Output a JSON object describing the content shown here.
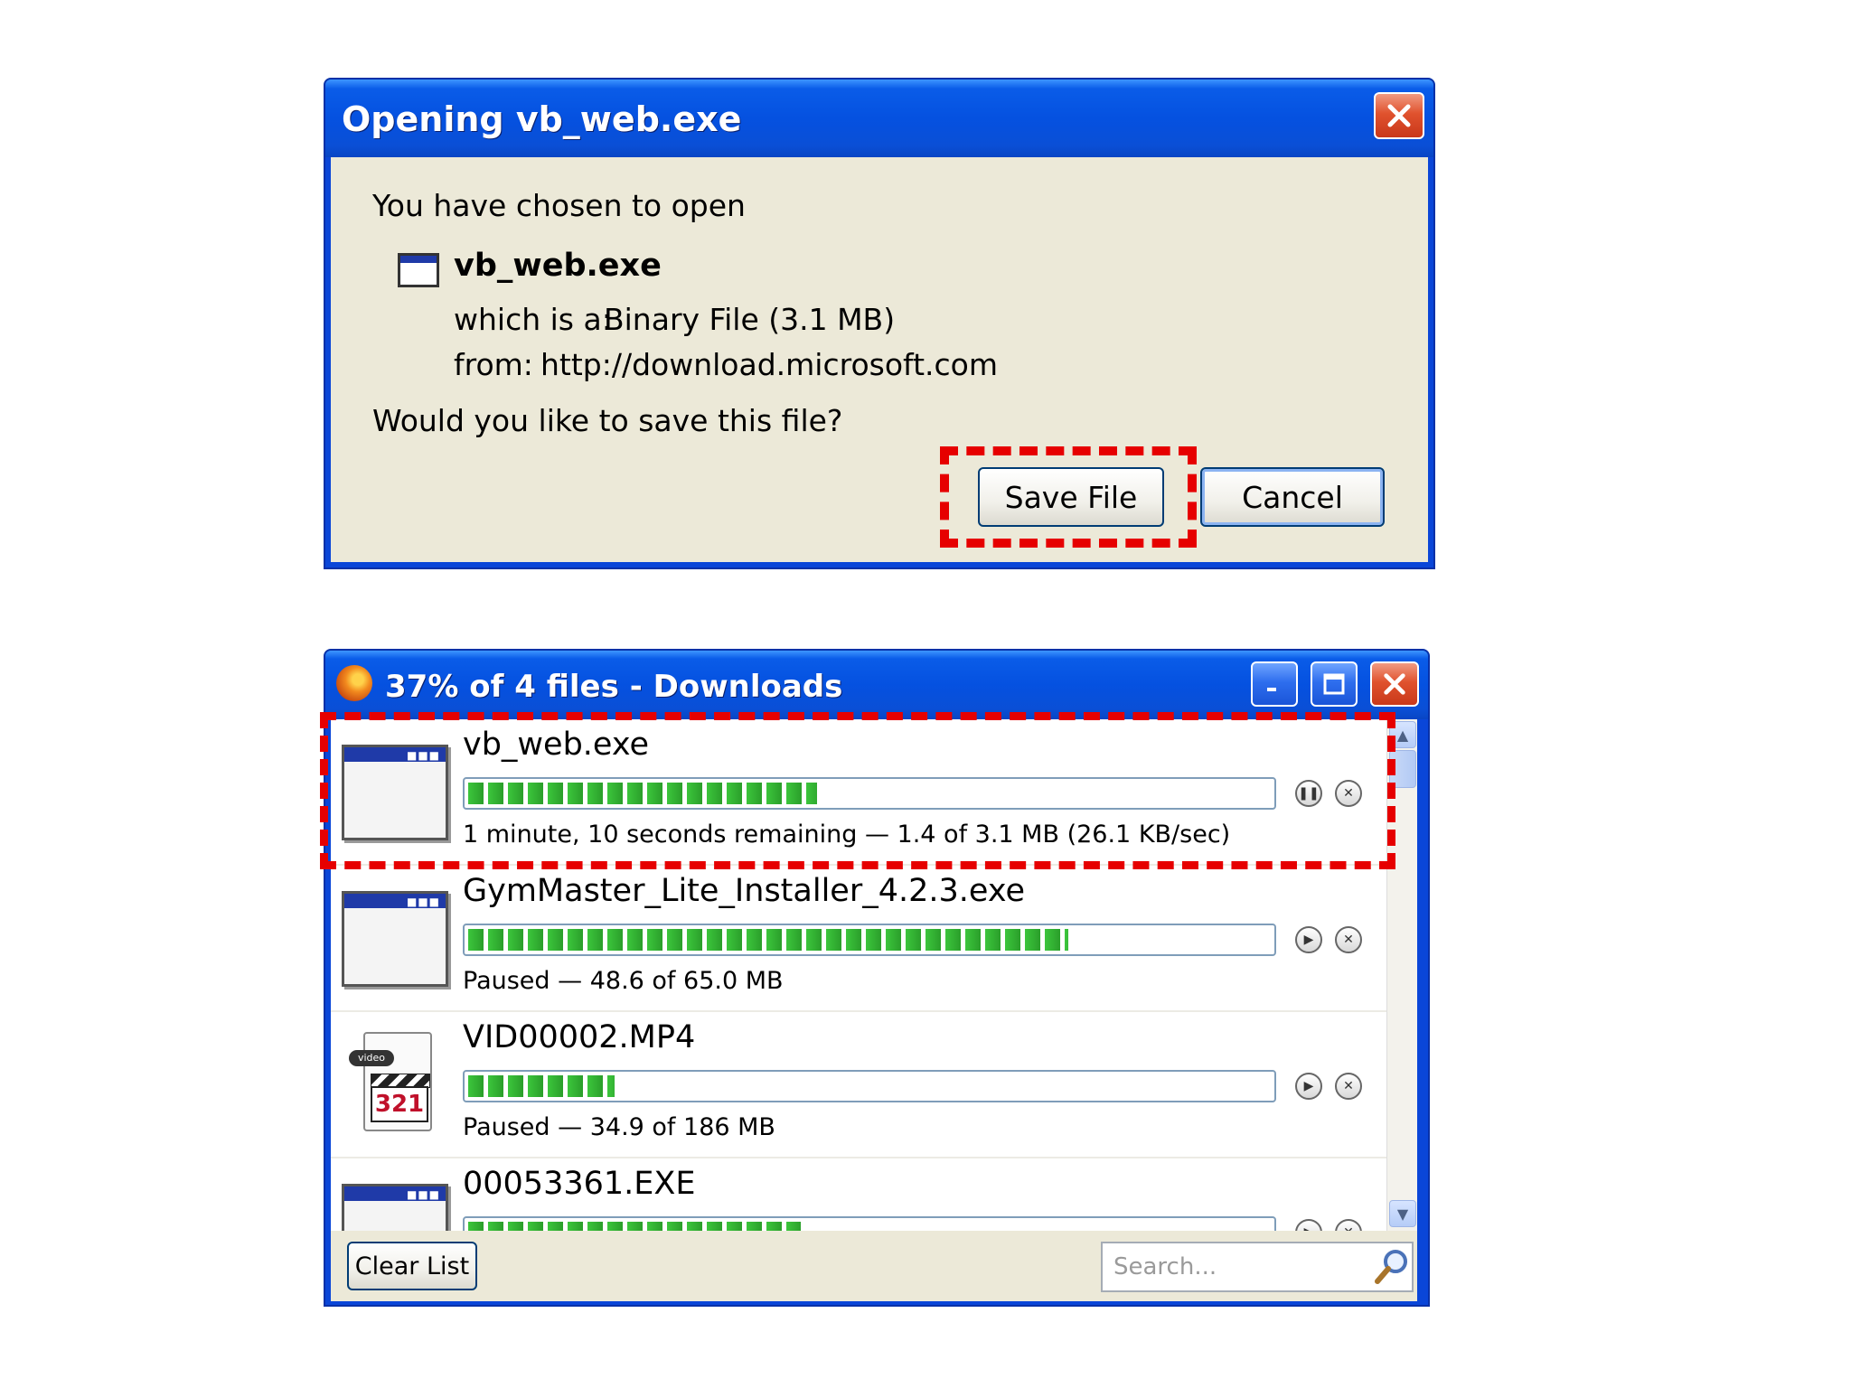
{
  "dialog": {
    "title": "Opening vb_web.exe",
    "intro": "You have chosen to open",
    "filename": "vb_web.exe",
    "type_label": "which is a:",
    "type_value": "Binary File (3.1 MB)",
    "from_label": "from:",
    "from_value": "http://download.microsoft.com",
    "question": "Would you like to save this file?",
    "save_label": "Save File",
    "cancel_label": "Cancel"
  },
  "downloads": {
    "title": "37% of 4 files - Downloads",
    "items": [
      {
        "name": "vb_web.exe",
        "progress": 0.44,
        "status": "1 minute, 10 seconds remaining — 1.4 of 3.1 MB (26.1 KB/sec)",
        "icon": "exe-icon",
        "action": "pause-icon"
      },
      {
        "name": "GymMaster_Lite_Installer_4.2.3.exe",
        "progress": 0.75,
        "status": "Paused — 48.6 of 65.0 MB",
        "icon": "exe-icon",
        "action": "resume-icon"
      },
      {
        "name": "VID00002.MP4",
        "progress": 0.19,
        "status": "Paused — 34.9 of 186 MB",
        "icon": "video-file-icon",
        "action": "resume-icon"
      },
      {
        "name": "00053361.EXE",
        "progress": 0.42,
        "status": "",
        "icon": "exe-icon",
        "action": "resume-icon"
      }
    ],
    "clear_list_label": "Clear List",
    "search_placeholder": "Search..."
  },
  "video_icon_text": {
    "tag": "video",
    "digits": "321"
  },
  "colors": {
    "highlight": "#e60000",
    "progress_green": "#2ba02b",
    "titlebar_blue": "#0a5ce8"
  }
}
